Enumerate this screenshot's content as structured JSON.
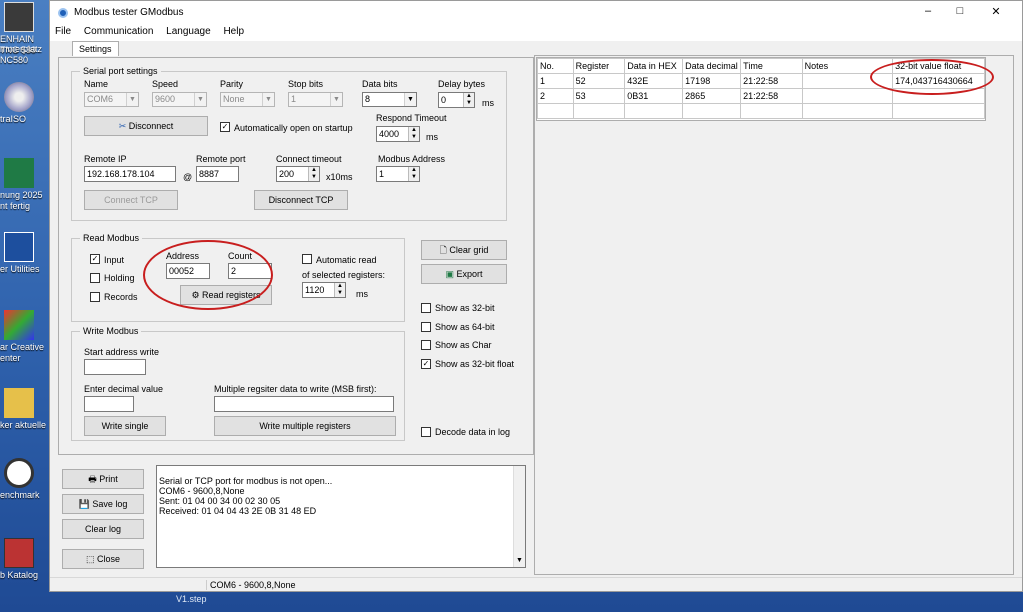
{
  "desktop": {
    "icons": [
      {
        "label": "ENHAIN TNC 530"
      },
      {
        "label": "mmerplatz NC580"
      },
      {
        "label": "traISO"
      },
      {
        "label": "nung 2025 nt fertig"
      },
      {
        "label": "er Utilities"
      },
      {
        "label": "ar Creative enter"
      },
      {
        "label": "ker aktuelle"
      },
      {
        "label": "enchmark"
      },
      {
        "label": "b Katalog"
      }
    ],
    "bottom_text": "V1.step"
  },
  "window": {
    "title": "Modbus tester GModbus",
    "controls": {
      "minimize": "–",
      "maximize": "□",
      "close": "✕"
    }
  },
  "menu": [
    "File",
    "Communication",
    "Language",
    "Help"
  ],
  "tabs": [
    {
      "label": "Settings"
    }
  ],
  "serial": {
    "group_label": "Serial port settings",
    "name_label": "Name",
    "name_value": "COM6",
    "speed_label": "Speed",
    "speed_value": "9600",
    "parity_label": "Parity",
    "parity_value": "None",
    "stopbits_label": "Stop bits",
    "stopbits_value": "1",
    "databits_label": "Data bits",
    "databits_value": "8",
    "delay_label": "Delay bytes",
    "delay_value": "0",
    "delay_unit": "ms",
    "disconnect_label": "Disconnect",
    "auto_open_label": "Automatically open on startup",
    "respond_label": "Respond Timeout",
    "respond_value": "4000",
    "respond_unit": "ms"
  },
  "tcp": {
    "remote_ip_label": "Remote IP",
    "remote_ip_value": "192.168.178.104",
    "at": "@",
    "remote_port_label": "Remote port",
    "remote_port_value": "8887",
    "connect_timeout_label": "Connect timeout",
    "connect_timeout_value": "200",
    "connect_timeout_unit": "x10ms",
    "modbus_address_label": "Modbus Address",
    "modbus_address_value": "1",
    "connect_label": "Connect TCP",
    "disconnect_label": "Disconnect TCP"
  },
  "read": {
    "group_label": "Read Modbus",
    "input_label": "Input",
    "holding_label": "Holding",
    "records_label": "Records",
    "address_label": "Address",
    "address_value": "00052",
    "count_label": "Count",
    "count_value": "2",
    "read_button": "Read registers",
    "auto_read_label": "Automatic read",
    "of_selected_label": "of selected registers:",
    "interval_value": "1120",
    "interval_unit": "ms"
  },
  "write": {
    "group_label": "Write Modbus",
    "start_label": "Start address write",
    "decimal_label": "Enter decimal value",
    "multiple_label": "Multiple regsiter data to write (MSB first):",
    "write_single": "Write single",
    "write_multiple": "Write multiple registers"
  },
  "right_controls": {
    "clear_grid": "Clear grid",
    "export": "Export",
    "show32": "Show as 32-bit",
    "show64": "Show as 64-bit",
    "showchar": "Show as Char",
    "show32float": "Show as 32-bit float",
    "decode": "Decode data in log"
  },
  "log_buttons": {
    "print": "Print",
    "save": "Save log",
    "clear": "Clear log",
    "close": "Close"
  },
  "log_lines": [
    "Serial or TCP port for modbus is not open...",
    "COM6 - 9600,8,None",
    "Sent: 01 04 00 34 00 02 30 05",
    "Received: 01 04 04 43 2E 0B 31 48 ED"
  ],
  "grid": {
    "headers": [
      "No.",
      "Register",
      "Data in HEX",
      "Data decimal",
      "Time",
      "Notes",
      "32-bit value float"
    ],
    "rows": [
      [
        "1",
        "52",
        "432E",
        "17198",
        "21:22:58",
        "",
        "174,043716430664"
      ],
      [
        "2",
        "53",
        "0B31",
        "2865",
        "21:22:58",
        "",
        ""
      ]
    ]
  },
  "status": {
    "text": "COM6 - 9600,8,None"
  },
  "colors": {
    "annotation": "#c81e1e",
    "desktop": "#2f62ad"
  }
}
